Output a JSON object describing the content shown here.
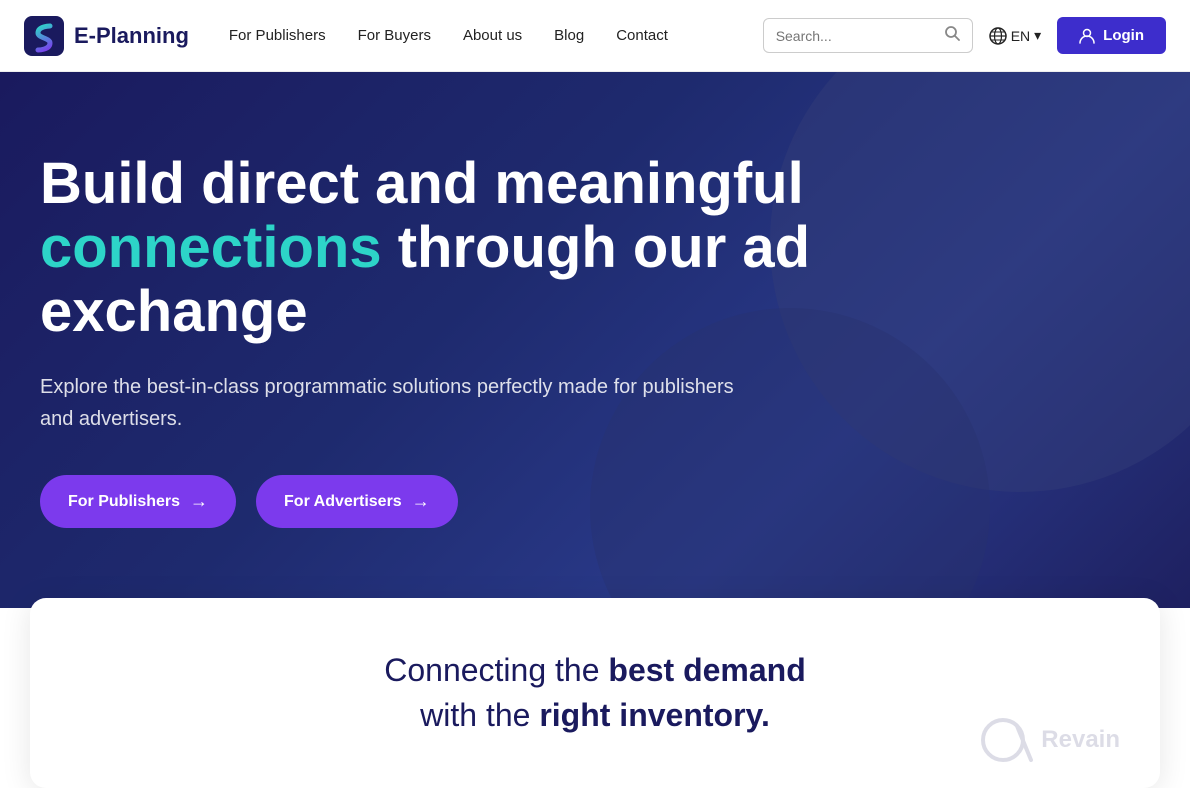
{
  "navbar": {
    "logo_text": "E-Planning",
    "nav_items": [
      {
        "label": "For Publishers",
        "id": "for-publishers"
      },
      {
        "label": "For Buyers",
        "id": "for-buyers"
      },
      {
        "label": "About us",
        "id": "about-us"
      },
      {
        "label": "Blog",
        "id": "blog"
      },
      {
        "label": "Contact",
        "id": "contact"
      }
    ],
    "search_placeholder": "Search...",
    "lang_label": "EN",
    "login_label": "Login"
  },
  "hero": {
    "title_part1": "Build direct and meaningful",
    "title_highlight": "connections",
    "title_part2": "through our ad exchange",
    "subtitle": "Explore the best-in-class programmatic solutions perfectly made for publishers and advertisers.",
    "btn_publishers": "For Publishers",
    "btn_advertisers": "For Advertisers"
  },
  "banner": {
    "text_part1": "Connecting the",
    "text_bold1": "best demand",
    "text_part2": "with the",
    "text_bold2": "right inventory.",
    "revain_text": "Revain"
  },
  "colors": {
    "accent_purple": "#7c3aed",
    "accent_teal": "#2dd4c8",
    "dark_navy": "#1a1a5e",
    "white": "#ffffff"
  }
}
